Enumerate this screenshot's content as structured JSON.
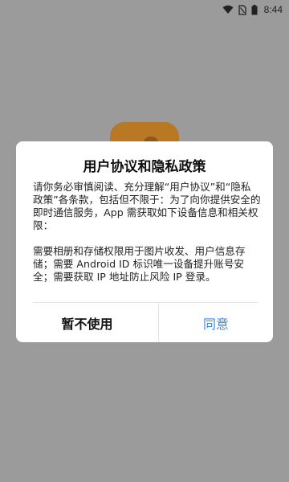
{
  "statusbar": {
    "time": "8:44",
    "icons": [
      "wifi-icon",
      "no-sim-icon",
      "battery-icon"
    ]
  },
  "dialog": {
    "title": "用户协议和隐私政策",
    "paragraph1": "请你务必审慎阅读、充分理解“用户协议”和“隐私政策”各条款，包括但不限于：为了向你提供安全的即时通信服务，App 需获取如下设备信息和相关权限：",
    "paragraph2": "需要相册和存储权限用于图片收发、用户信息存储；需要 Android ID 标识唯一设备提升账号安全；需要获取 IP 地址防止风险 IP 登录。",
    "cancel_label": "暂不使用",
    "agree_label": "同意"
  },
  "colors": {
    "accent": "#3b8be0",
    "scrim": "#9b9b9b",
    "logo": "#b87824"
  }
}
